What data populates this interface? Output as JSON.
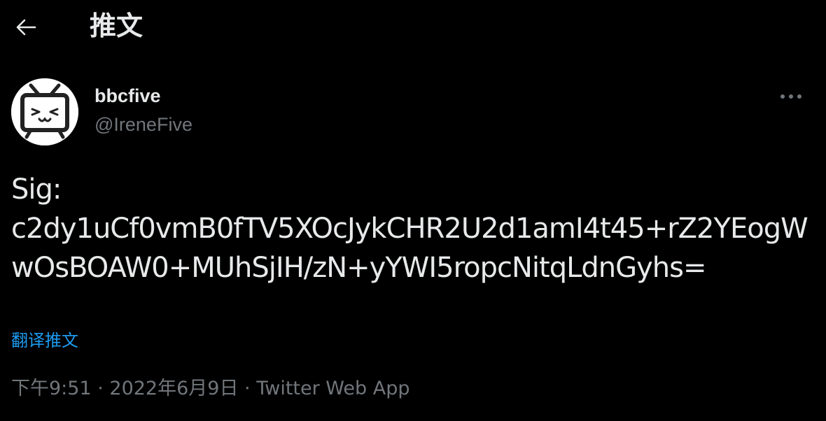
{
  "header": {
    "back_icon": "arrow-left-icon",
    "title": "推文"
  },
  "author": {
    "avatar_icon": "bilibili-tv-mascot",
    "display_name": "bbcfive",
    "handle": "@IreneFive"
  },
  "more_icon": "more-horizontal-icon",
  "tweet": {
    "text": "Sig:\nc2dy1uCf0vmB0fTV5XOcJykCHR2U2d1amI4t45+rZ2YEogWwOsBOAW0+MUhSjIH/zN+yYWI5ropcNitqLdnGyhs=",
    "translate_label": "翻译推文"
  },
  "meta": {
    "time": "下午9:51",
    "separator": " · ",
    "date": "2022年6月9日",
    "source": "Twitter Web App"
  },
  "colors": {
    "background": "#000000",
    "text_primary": "#e7e9ea",
    "text_secondary": "#71767b",
    "accent": "#1d9bf0"
  }
}
